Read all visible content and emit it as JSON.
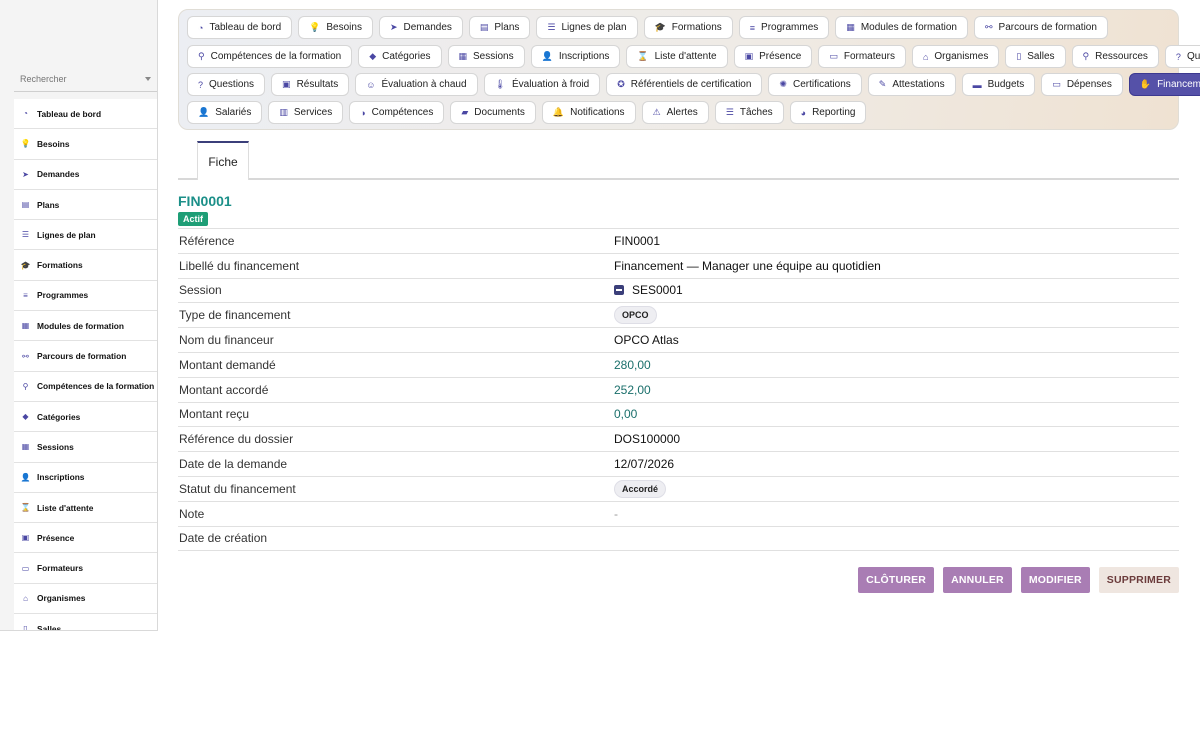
{
  "sidebar": {
    "search_placeholder": "Rechercher",
    "items": [
      {
        "label": "Tableau de bord",
        "icon": "dashboard-icon",
        "glyph": "◔"
      },
      {
        "label": "Besoins",
        "icon": "bulb-icon",
        "glyph": "💡"
      },
      {
        "label": "Demandes",
        "icon": "paper-plane-icon",
        "glyph": "➤"
      },
      {
        "label": "Plans",
        "icon": "clipboard-icon",
        "glyph": "▤"
      },
      {
        "label": "Lignes de plan",
        "icon": "list-icon",
        "glyph": "☰"
      },
      {
        "label": "Formations",
        "icon": "graduation-cap-icon",
        "glyph": "🎓"
      },
      {
        "label": "Programmes",
        "icon": "bars-icon",
        "glyph": "≡"
      },
      {
        "label": "Modules de formation",
        "icon": "cubes-icon",
        "glyph": "▦"
      },
      {
        "label": "Parcours de formation",
        "icon": "route-icon",
        "glyph": "⚯"
      },
      {
        "label": "Compétences de la formation",
        "icon": "sitemap-icon",
        "glyph": "⚲"
      },
      {
        "label": "Catégories",
        "icon": "tags-icon",
        "glyph": "◆"
      },
      {
        "label": "Sessions",
        "icon": "calendar-icon",
        "glyph": "▦"
      },
      {
        "label": "Inscriptions",
        "icon": "user-plus-icon",
        "glyph": "👤"
      },
      {
        "label": "Liste d'attente",
        "icon": "hourglass-icon",
        "glyph": "⌛"
      },
      {
        "label": "Présence",
        "icon": "clipboard-check-icon",
        "glyph": "▣"
      },
      {
        "label": "Formateurs",
        "icon": "chalkboard-teacher-icon",
        "glyph": "▭"
      },
      {
        "label": "Organismes",
        "icon": "landmark-icon",
        "glyph": "⌂"
      },
      {
        "label": "Salles",
        "icon": "door-icon",
        "glyph": "▯"
      }
    ]
  },
  "topnav": {
    "rows": [
      [
        {
          "label": "Tableau de bord",
          "icon": "dashboard-icon",
          "glyph": "◔"
        },
        {
          "label": "Besoins",
          "icon": "bulb-icon",
          "glyph": "💡"
        },
        {
          "label": "Demandes",
          "icon": "paper-plane-icon",
          "glyph": "➤"
        },
        {
          "label": "Plans",
          "icon": "clipboard-icon",
          "glyph": "▤"
        },
        {
          "label": "Lignes de plan",
          "icon": "list-icon",
          "glyph": "☰"
        },
        {
          "label": "Formations",
          "icon": "graduation-cap-icon",
          "glyph": "🎓"
        },
        {
          "label": "Programmes",
          "icon": "bars-icon",
          "glyph": "≡"
        },
        {
          "label": "Modules de formation",
          "icon": "cubes-icon",
          "glyph": "▦"
        },
        {
          "label": "Parcours de formation",
          "icon": "route-icon",
          "glyph": "⚯"
        }
      ],
      [
        {
          "label": "Compétences de la formation",
          "icon": "sitemap-icon",
          "glyph": "⚲"
        },
        {
          "label": "Catégories",
          "icon": "tags-icon",
          "glyph": "◆"
        },
        {
          "label": "Sessions",
          "icon": "calendar-icon",
          "glyph": "▦"
        },
        {
          "label": "Inscriptions",
          "icon": "user-plus-icon",
          "glyph": "👤"
        },
        {
          "label": "Liste d'attente",
          "icon": "hourglass-icon",
          "glyph": "⌛"
        },
        {
          "label": "Présence",
          "icon": "clipboard-check-icon",
          "glyph": "▣"
        },
        {
          "label": "Formateurs",
          "icon": "chalkboard-teacher-icon",
          "glyph": "▭"
        },
        {
          "label": "Organismes",
          "icon": "landmark-icon",
          "glyph": "⌂"
        },
        {
          "label": "Salles",
          "icon": "door-icon",
          "glyph": "▯"
        },
        {
          "label": "Ressources",
          "icon": "sitemap-icon",
          "glyph": "⚲"
        },
        {
          "label": "Quiz",
          "icon": "question-circle-icon",
          "glyph": "?"
        }
      ],
      [
        {
          "label": "Questions",
          "icon": "question-icon",
          "glyph": "?"
        },
        {
          "label": "Résultats",
          "icon": "poll-icon",
          "glyph": "▣"
        },
        {
          "label": "Évaluation à chaud",
          "icon": "smile-icon",
          "glyph": "☺"
        },
        {
          "label": "Évaluation à froid",
          "icon": "thermometer-icon",
          "glyph": "🌡"
        },
        {
          "label": "Référentiels de certification",
          "icon": "award-icon",
          "glyph": "✪"
        },
        {
          "label": "Certifications",
          "icon": "certificate-icon",
          "glyph": "✺"
        },
        {
          "label": "Attestations",
          "icon": "file-signature-icon",
          "glyph": "✎"
        },
        {
          "label": "Budgets",
          "icon": "wallet-icon",
          "glyph": "▬"
        },
        {
          "label": "Dépenses",
          "icon": "money-bill-icon",
          "glyph": "▭"
        },
        {
          "label": "Financements",
          "icon": "hand-holding-usd-icon",
          "glyph": "✋",
          "active": true
        }
      ],
      [
        {
          "label": "Salariés",
          "icon": "user-icon",
          "glyph": "👤"
        },
        {
          "label": "Services",
          "icon": "building-icon",
          "glyph": "▥"
        },
        {
          "label": "Compétences",
          "icon": "brain-icon",
          "glyph": "◑"
        },
        {
          "label": "Documents",
          "icon": "folder-open-icon",
          "glyph": "▰"
        },
        {
          "label": "Notifications",
          "icon": "bell-icon",
          "glyph": "🔔"
        },
        {
          "label": "Alertes",
          "icon": "warning-icon",
          "glyph": "⚠"
        },
        {
          "label": "Tâches",
          "icon": "tasks-icon",
          "glyph": "☰"
        },
        {
          "label": "Reporting",
          "icon": "chart-pie-icon",
          "glyph": "◕"
        }
      ]
    ]
  },
  "tab": {
    "label": "Fiche"
  },
  "record": {
    "title": "FIN0001",
    "status_badge": "Actif",
    "fields": [
      {
        "label": "Référence",
        "value": "FIN0001",
        "kind": "text"
      },
      {
        "label": "Libellé du financement",
        "value": "Financement — Manager une équipe au quotidien",
        "kind": "text"
      },
      {
        "label": "Session",
        "value": "SES0001",
        "kind": "session"
      },
      {
        "label": "Type de financement",
        "value": "OPCO",
        "kind": "chip"
      },
      {
        "label": "Nom du financeur",
        "value": "OPCO Atlas",
        "kind": "text"
      },
      {
        "label": "Montant demandé",
        "value": "280,00",
        "kind": "money"
      },
      {
        "label": "Montant accordé",
        "value": "252,00",
        "kind": "money"
      },
      {
        "label": "Montant reçu",
        "value": "0,00",
        "kind": "money"
      },
      {
        "label": "Référence du dossier",
        "value": "DOS100000",
        "kind": "text"
      },
      {
        "label": "Date de la demande",
        "value": "12/07/2026",
        "kind": "text"
      },
      {
        "label": "Statut du financement",
        "value": "Accordé",
        "kind": "chip"
      },
      {
        "label": "Note",
        "value": "-",
        "kind": "muted"
      },
      {
        "label": "Date de création",
        "value": "",
        "kind": "text"
      }
    ]
  },
  "actions": {
    "cloturer": "CLÔTURER",
    "annuler": "ANNULER",
    "modifier": "MODIFIER",
    "supprimer": "SUPPRIMER"
  },
  "colors": {
    "accent": "#5551a8",
    "title_teal": "#1b8f88",
    "badge_green": "#1e9e76",
    "button_purple": "#a97db4"
  }
}
